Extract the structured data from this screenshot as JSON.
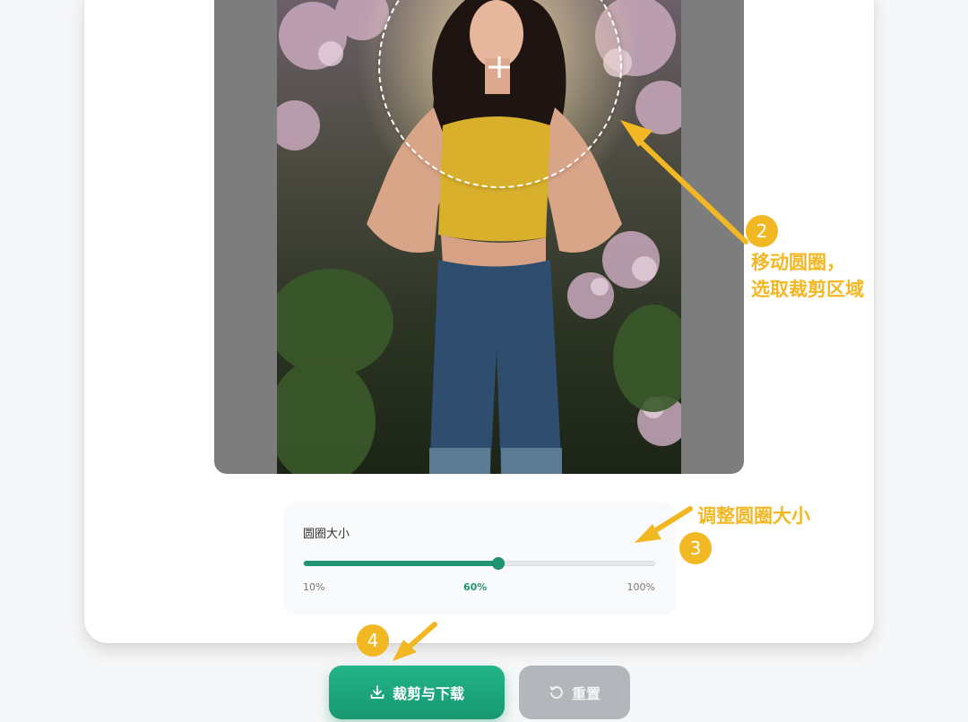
{
  "editor": {
    "crop_shape": "circle"
  },
  "slider": {
    "title": "圆圈大小",
    "min_label": "10%",
    "current_label": "60%",
    "max_label": "100%",
    "value_percent": 60,
    "min": 10,
    "max": 100
  },
  "actions": {
    "crop_download_label": "裁剪与下载",
    "reset_label": "重置"
  },
  "annotations": {
    "step2_number": "2",
    "step2_line1": "移动圆圈，",
    "step2_line2": "选取裁剪区域",
    "step3_number": "3",
    "step3_text": "调整圆圈大小",
    "step4_number": "4"
  },
  "icons": {
    "crop_download": "download-icon",
    "reset": "reset-icon",
    "move_handle": "crosshair-icon"
  },
  "colors": {
    "accent": "#1f9670",
    "annotation": "#f2b824",
    "stage_bg": "#7d7d7d",
    "reset_button": "#b3b6ba"
  }
}
